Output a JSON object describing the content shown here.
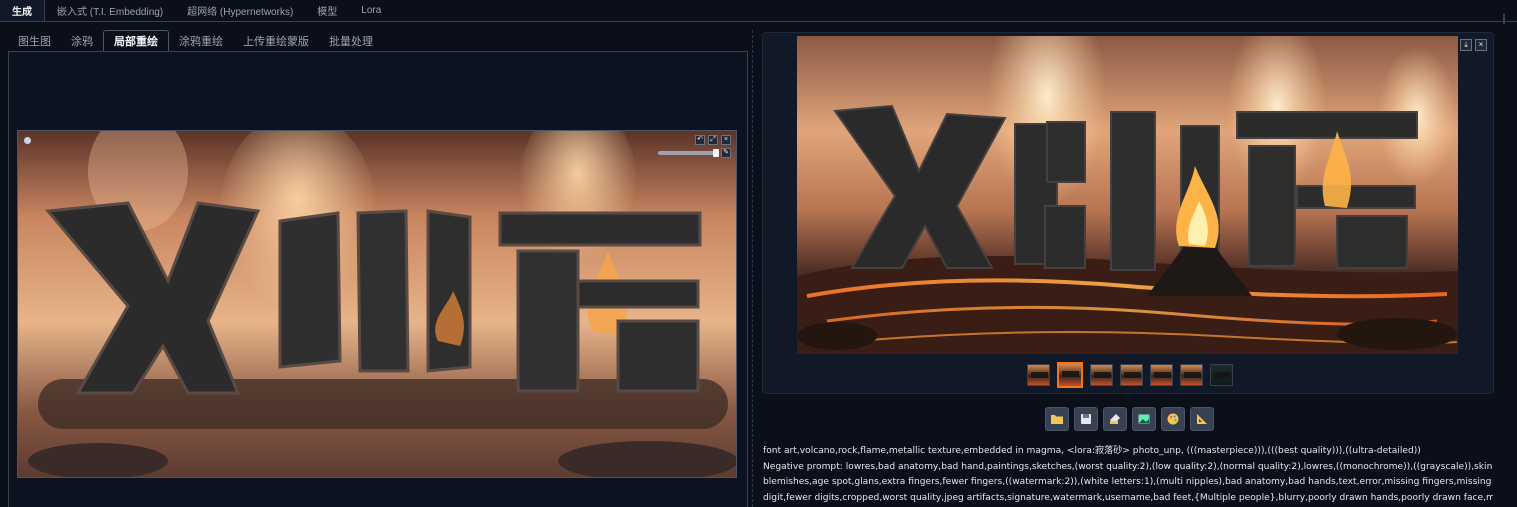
{
  "top_tabs": [
    "生成",
    "嵌入式 (T.I. Embedding)",
    "超网络 (Hypernetworks)",
    "模型",
    "Lora"
  ],
  "sub_tabs": [
    "图生图",
    "涂鸦",
    "局部重绘",
    "涂鸦重绘",
    "上传重绘蒙版",
    "批量处理"
  ],
  "active_top_tab": 0,
  "active_sub_tab": 2,
  "canvas_image": {
    "subject": "火山岩 text sculpture with mask overlay",
    "alt": "inpaint canvas image"
  },
  "canvas_controls": {
    "undo": "↶",
    "clear": "⤢",
    "close": "×",
    "brush": "✎"
  },
  "gallery_tools": {
    "download": "⤓",
    "close": "×"
  },
  "result_image": {
    "alt": "generated result image"
  },
  "thumbnails": [
    {
      "kind": "fire",
      "selected": false
    },
    {
      "kind": "fire",
      "selected": true
    },
    {
      "kind": "fire",
      "selected": false
    },
    {
      "kind": "fire",
      "selected": false
    },
    {
      "kind": "fire",
      "selected": false
    },
    {
      "kind": "fire",
      "selected": false
    },
    {
      "kind": "dark",
      "selected": false
    }
  ],
  "action_buttons": [
    "folder-icon",
    "save-icon",
    "zip-icon",
    "image-icon",
    "palette-icon",
    "ruler-icon"
  ],
  "generation_info": {
    "line1": "font art,volcano,rock,flame,metallic texture,embedded in magma, <lora:寂落砂>  photo_unp, (((masterpiece))),(((best quality))),((ultra-detailed))",
    "line2": "Negative prompt: lowres,bad anatomy,bad hand,paintings,sketches,(worst quality:2),(low quality:2),(normal quality:2),lowres,((monochrome)),((grayscale)),skin spots,acnes,skin",
    "line3": "blemishes,age spot,glans,extra fingers,fewer fingers,((watermark:2)),(white letters:1),(multi nipples),bad anatomy,bad hands,text,error,missing fingers,missing arms,missing legs,extra",
    "line4": "digit,fewer digits,cropped,worst quality,jpeg artifacts,signature,watermark,username,bad feet,{Multiple people},blurry,poorly drawn hands,poorly drawn face,mutation,deformed,extra"
  },
  "colors": {
    "background": "#0b0f19",
    "accent": "#f97316",
    "fire": "#f4a460",
    "rock": "#2a2a2a"
  }
}
